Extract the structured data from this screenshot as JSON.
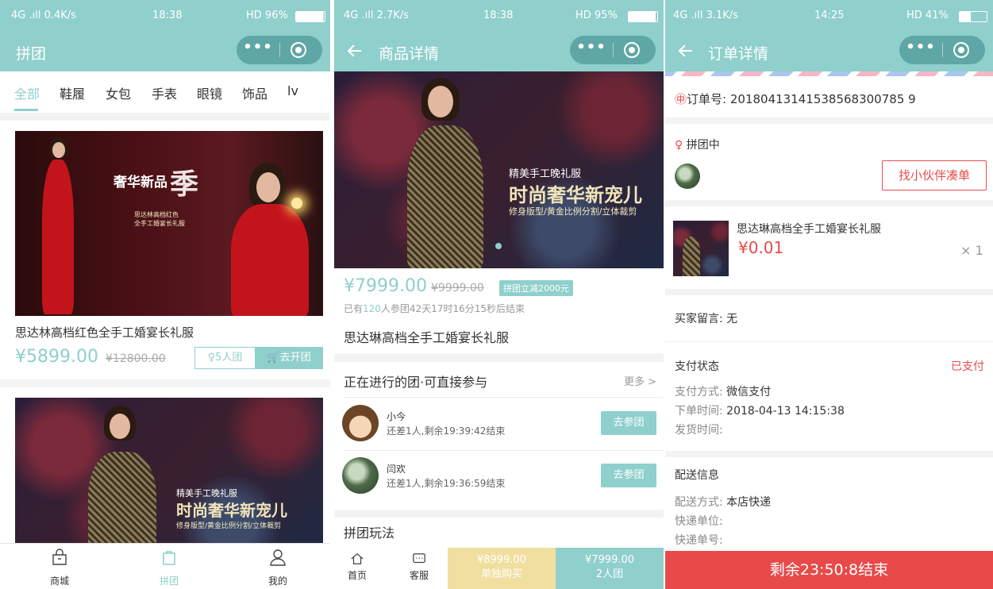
{
  "screen1": {
    "status": {
      "signal": "4G .ıll  0.4K/s",
      "time": "18:38",
      "right": "HD  96%"
    },
    "nav": {
      "title": "拼团"
    },
    "categories": [
      "全部",
      "鞋履",
      "女包",
      "手表",
      "眼镜",
      "饰品",
      "lv"
    ],
    "products": [
      {
        "title": "思达林高档红色全手工婚宴长礼服",
        "price": "¥5899.00",
        "old_price": "¥12800.00",
        "group_label": "5人团",
        "open_label": "去开团",
        "banner_title": "奢华新品",
        "banner_char": "季",
        "banner_sub": "思达林高档红色\n全手工婚宴长礼服"
      },
      {
        "banner_top": "精美手工晚礼服",
        "banner_main": "时尚奢华新宠儿",
        "banner_sub": "修身版型/黄金比例分割/立体裁剪"
      }
    ],
    "tabbar": [
      {
        "label": "商城",
        "icon": "shop-icon"
      },
      {
        "label": "拼团",
        "icon": "group-icon"
      },
      {
        "label": "我的",
        "icon": "user-icon"
      }
    ]
  },
  "screen2": {
    "status": {
      "signal": "4G .ıll  2.7K/s",
      "time": "18:38",
      "right": "HD  95%"
    },
    "nav": {
      "title": "商品详情"
    },
    "banner": {
      "top": "精美手工晚礼服",
      "main": "时尚奢华新宠儿",
      "sub": "修身版型/黄金比例分割/立体裁剪"
    },
    "price": "¥7999.00",
    "old_price": "¥9999.00",
    "tag": "拼团立减2000元",
    "joined_prefix": "已有",
    "joined_count": "120",
    "joined_suffix": "人参团42天17时16分15秒后结束",
    "title": "思达琳高档全手工婚宴长礼服",
    "ongoing_title": "正在进行的团·可直接参与",
    "more": "更多 >",
    "groups": [
      {
        "name": "小今",
        "sub": "还差1人,剩余19:39:42结束",
        "button": "去参团"
      },
      {
        "name": "闫欢",
        "sub": "还差1人,剩余19:36:59结束",
        "button": "去参团"
      }
    ],
    "rules_title": "拼团玩法",
    "bottom": {
      "home": "首页",
      "service": "客服",
      "solo_price": "¥8999.00",
      "solo_label": "单独购买",
      "group_price": "¥7999.00",
      "group_label": "2人团"
    }
  },
  "screen3": {
    "status": {
      "signal": "4G .ıll  3.1K/s",
      "time": "14:25",
      "right": "HD  41%"
    },
    "nav": {
      "title": "订单详情"
    },
    "order_no_label": "订单号:",
    "order_no": "20180413141538568300785 9",
    "group_status": "拼团中",
    "invite_button": "找小伙伴凑单",
    "item": {
      "title": "思达琳高档全手工婚宴长礼服",
      "price": "¥0.01",
      "qty": "× 1"
    },
    "message_label": "买家留言:",
    "message": "无",
    "pay_status_label": "支付状态",
    "pay_status": "已支付",
    "pay_method_label": "支付方式:",
    "pay_method": "微信支付",
    "order_time_label": "下单时间:",
    "order_time": "2018-04-13 14:15:38",
    "ship_time_label": "发货时间:",
    "delivery_title": "配送信息",
    "delivery_method_label": "配送方式:",
    "delivery_method": "本店快递",
    "courier_label": "快递单位:",
    "tracking_label": "快递单号:",
    "countdown": "剩余23:50:8结束"
  },
  "colors": {
    "accent": "#8fcfcc",
    "red": "#e84a4a",
    "capsule": "#5fa7a5"
  }
}
